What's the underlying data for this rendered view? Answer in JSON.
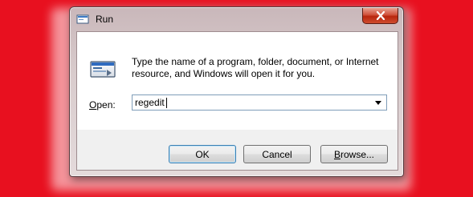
{
  "dialog": {
    "title": "Run",
    "description": "Type the name of a program, folder, document, or Internet resource, and Windows will open it for you.",
    "open_label_prefix": "O",
    "open_label_rest": "pen:",
    "open_value": "regedit"
  },
  "buttons": {
    "ok": "OK",
    "cancel": "Cancel",
    "browse_prefix": "B",
    "browse_rest": "rowse..."
  },
  "icons": {
    "title": "run-icon",
    "close": "close-icon",
    "dropdown": "chevron-down-icon",
    "program": "run-program-icon"
  },
  "colors": {
    "background": "#e8101f",
    "close_button": "#c7391c",
    "default_button_border": "#3c7fb1"
  }
}
